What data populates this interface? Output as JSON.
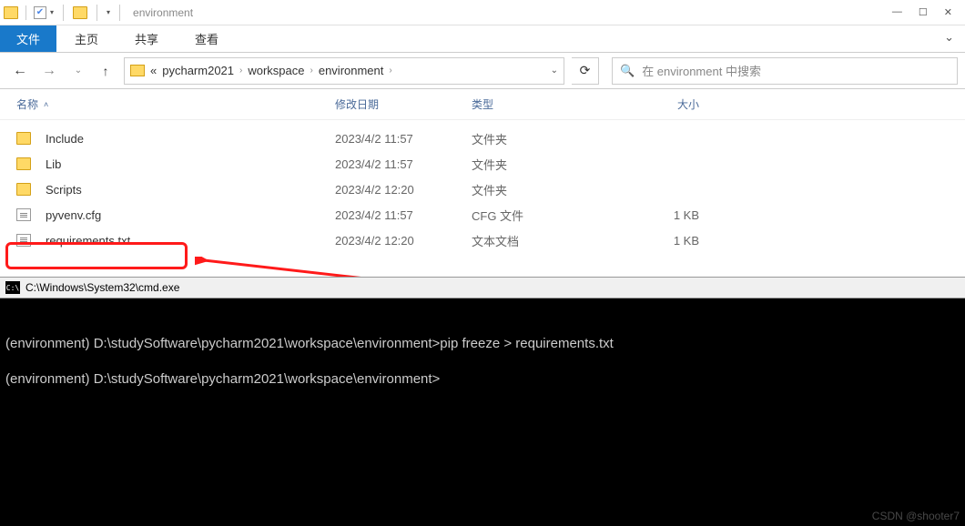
{
  "window": {
    "title": "environment",
    "minimize": "—",
    "maximize": "☐",
    "close": "✕"
  },
  "ribbon": {
    "file": "文件",
    "home": "主页",
    "share": "共享",
    "view": "查看",
    "expand": "⌄"
  },
  "nav": {
    "back": "←",
    "forward": "→",
    "recent_drop": "⌄",
    "up": "↑"
  },
  "breadcrumb": {
    "prefix": "«",
    "items": [
      "pycharm2021",
      "workspace",
      "environment"
    ]
  },
  "refresh": "⟳",
  "search": {
    "placeholder": "在 environment 中搜索",
    "icon": "🔍"
  },
  "columns": {
    "name": "名称",
    "date": "修改日期",
    "type": "类型",
    "size": "大小"
  },
  "files": [
    {
      "name": "Include",
      "date": "2023/4/2 11:57",
      "type": "文件夹",
      "size": "",
      "icon": "folder"
    },
    {
      "name": "Lib",
      "date": "2023/4/2 11:57",
      "type": "文件夹",
      "size": "",
      "icon": "folder"
    },
    {
      "name": "Scripts",
      "date": "2023/4/2 12:20",
      "type": "文件夹",
      "size": "",
      "icon": "folder"
    },
    {
      "name": "pyvenv.cfg",
      "date": "2023/4/2 11:57",
      "type": "CFG 文件",
      "size": "1 KB",
      "icon": "cfg"
    },
    {
      "name": "requirements.txt",
      "date": "2023/4/2 12:20",
      "type": "文本文档",
      "size": "1 KB",
      "icon": "txt"
    }
  ],
  "terminal_title": "C:\\Windows\\System32\\cmd.exe",
  "terminal_lines": {
    "line1": "(environment) D:\\studySoftware\\pycharm2021\\workspace\\environment>pip freeze > requirements.txt",
    "line2": "(environment) D:\\studySoftware\\pycharm2021\\workspace\\environment>"
  },
  "watermark": "CSDN @shooter7"
}
